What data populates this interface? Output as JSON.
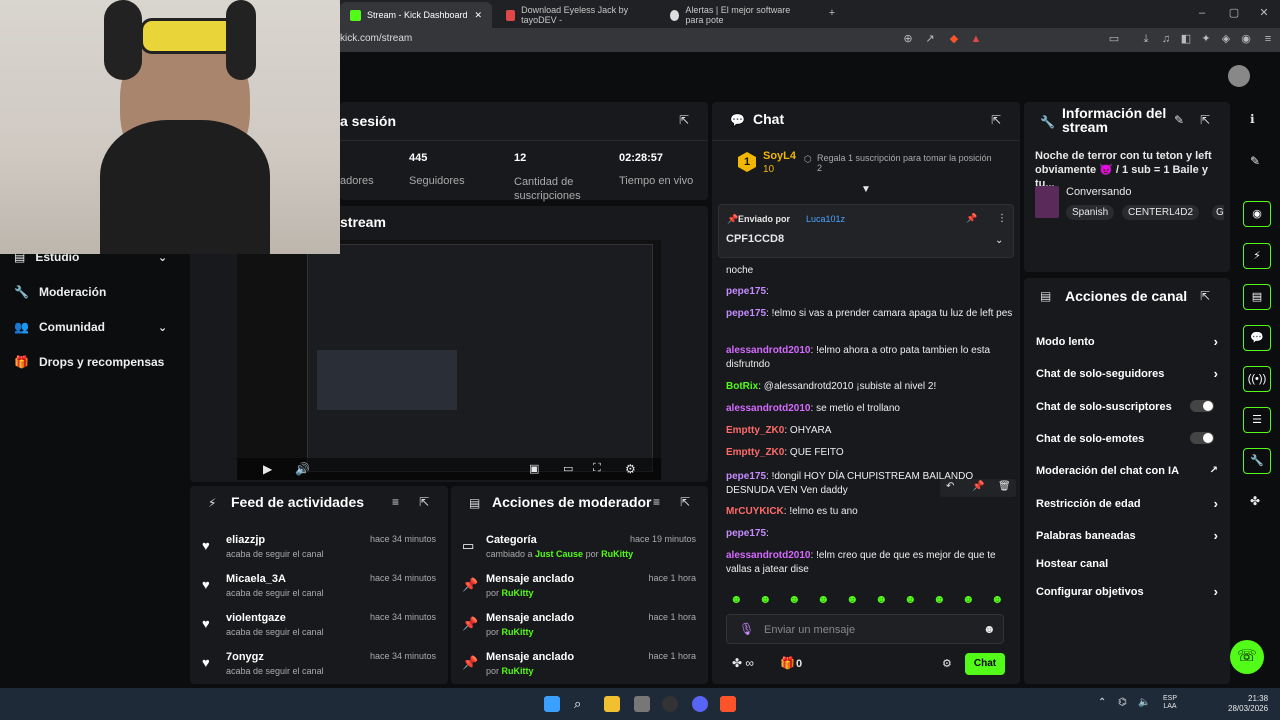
{
  "browser": {
    "tabs": [
      {
        "label": "Stream - Kick Dashboard",
        "active": true
      },
      {
        "label": "Download Eyeless Jack by tayoDEV -",
        "active": false
      },
      {
        "label": "Alertas | El mejor software para pote",
        "active": false
      }
    ],
    "url": "kick.com/stream"
  },
  "stats": {
    "session_title": "a sesión",
    "stream_title": "stream",
    "items": [
      {
        "value": "",
        "label": "adores"
      },
      {
        "value": "445",
        "label": "Seguidores"
      },
      {
        "value": "12",
        "label": "Cantidad de suscripciones"
      },
      {
        "value": "02:28:57",
        "label": "Tiempo en vivo"
      }
    ]
  },
  "sidebar": {
    "items": [
      {
        "label": "Estudio",
        "icon": "studio-icon"
      },
      {
        "label": "Moderación",
        "icon": "wrench-icon"
      },
      {
        "label": "Comunidad",
        "icon": "users-icon"
      },
      {
        "label": "Drops y recompensas",
        "icon": "gift-icon"
      }
    ]
  },
  "feed": {
    "title": "Feed de actividades",
    "items": [
      {
        "name": "eliazzjp",
        "sub": "acaba de seguir el canal",
        "time": "hace 34 minutos"
      },
      {
        "name": "Micaela_3A",
        "sub": "acaba de seguir el canal",
        "time": "hace 34 minutos"
      },
      {
        "name": "violentgaze",
        "sub": "acaba de seguir el canal",
        "time": "hace 34 minutos"
      },
      {
        "name": "7onygz",
        "sub": "acaba de seguir el canal",
        "time": "hace 34 minutos"
      }
    ]
  },
  "mod_actions": {
    "title": "Acciones de moderador",
    "items": [
      {
        "name": "Categoría",
        "pre": "cambiado a ",
        "value": "Just Cause",
        "mid": " por ",
        "user": "RuKitty",
        "time": "hace 19 minutos"
      },
      {
        "name": "Mensaje anclado",
        "pre": "por ",
        "value": "",
        "mid": "",
        "user": "RuKitty",
        "time": "hace 1 hora"
      },
      {
        "name": "Mensaje anclado",
        "pre": "por ",
        "value": "",
        "mid": "",
        "user": "RuKitty",
        "time": "hace 1 hora"
      },
      {
        "name": "Mensaje anclado",
        "pre": "por ",
        "value": "",
        "mid": "",
        "user": "RuKitty",
        "time": "hace 1 hora"
      }
    ]
  },
  "chat": {
    "title": "Chat",
    "top_gifter": {
      "rank": "1",
      "name": "SoyL4",
      "count": "10"
    },
    "gift_prompt": "Regala 1 suscripción para tomar la posición 2",
    "pinned": {
      "label": "Enviado por",
      "user": "Luca101z",
      "text": "CPF1CCD8"
    },
    "messages": [
      {
        "user": "",
        "text": "noche",
        "cls": ""
      },
      {
        "user": "pepe175",
        "text": "",
        "cls": "u-purple"
      },
      {
        "user": "pepe175",
        "text": "!elmo si vas a prender camara apaga tu luz de left pes",
        "cls": "u-purple"
      },
      {
        "user": "alessandrotd2010",
        "text": "!elmo ahora a otro pata tambien lo esta disfrutndo",
        "cls": "u-pink"
      },
      {
        "user": "BotRix",
        "text": "@alessandrotd2010 ¡subiste al nivel 2!",
        "cls": "u-green"
      },
      {
        "user": "alessandrotd2010",
        "text": "se metio el trollano",
        "cls": "u-pink"
      },
      {
        "user": "Emptty_ZK0",
        "text": "OHYARA",
        "cls": "u-red"
      },
      {
        "user": "Emptty_ZK0",
        "text": "QUE FEITO",
        "cls": "u-red"
      },
      {
        "user": "pepe175",
        "text": "!dongil HOY DÍA CHUPISTREAM BAILANDO DESNUDA VEN Ven daddy",
        "cls": "u-purple"
      },
      {
        "user": "MrCUYKICK",
        "text": "!elmo es tu ano",
        "cls": "u-red"
      },
      {
        "user": "pepe175",
        "text": "",
        "cls": "u-purple"
      },
      {
        "user": "alessandrotd2010",
        "text": "!elm creo que de que es mejor de que te vallas a jatear dise",
        "cls": "u-pink"
      }
    ],
    "input_placeholder": "Enviar un mensaje",
    "send_label": "Chat",
    "points": "0"
  },
  "stream_info": {
    "title": "Información del stream",
    "description": "Noche de terror con tu teton y left obviamente 👿 / 1 sub = 1 Baile y tu...",
    "category": "Conversando",
    "tags": [
      "Spanish",
      "CENTERL4D2",
      "G"
    ]
  },
  "channel_actions": {
    "title": "Acciones de canal",
    "items": [
      {
        "label": "Modo lento",
        "control": "chevron"
      },
      {
        "label": "Chat de solo-seguidores",
        "control": "chevron"
      },
      {
        "label": "Chat de solo-suscriptores",
        "control": "toggle"
      },
      {
        "label": "Chat de solo-emotes",
        "control": "toggle"
      },
      {
        "label": "Moderación del chat con IA",
        "control": "external"
      },
      {
        "label": "Restricción de edad",
        "control": "chevron"
      },
      {
        "label": "Palabras baneadas",
        "control": "chevron"
      },
      {
        "label": "Hostear canal",
        "control": "none"
      },
      {
        "label": "Configurar objetivos",
        "control": "chevron"
      }
    ]
  },
  "taskbar": {
    "lang": "ESP LAA",
    "time": "21:38",
    "date": "28/03/2026"
  },
  "colors": {
    "accent": "#53fc18",
    "panel": "#18191c",
    "bg": "#0b0d0f"
  }
}
